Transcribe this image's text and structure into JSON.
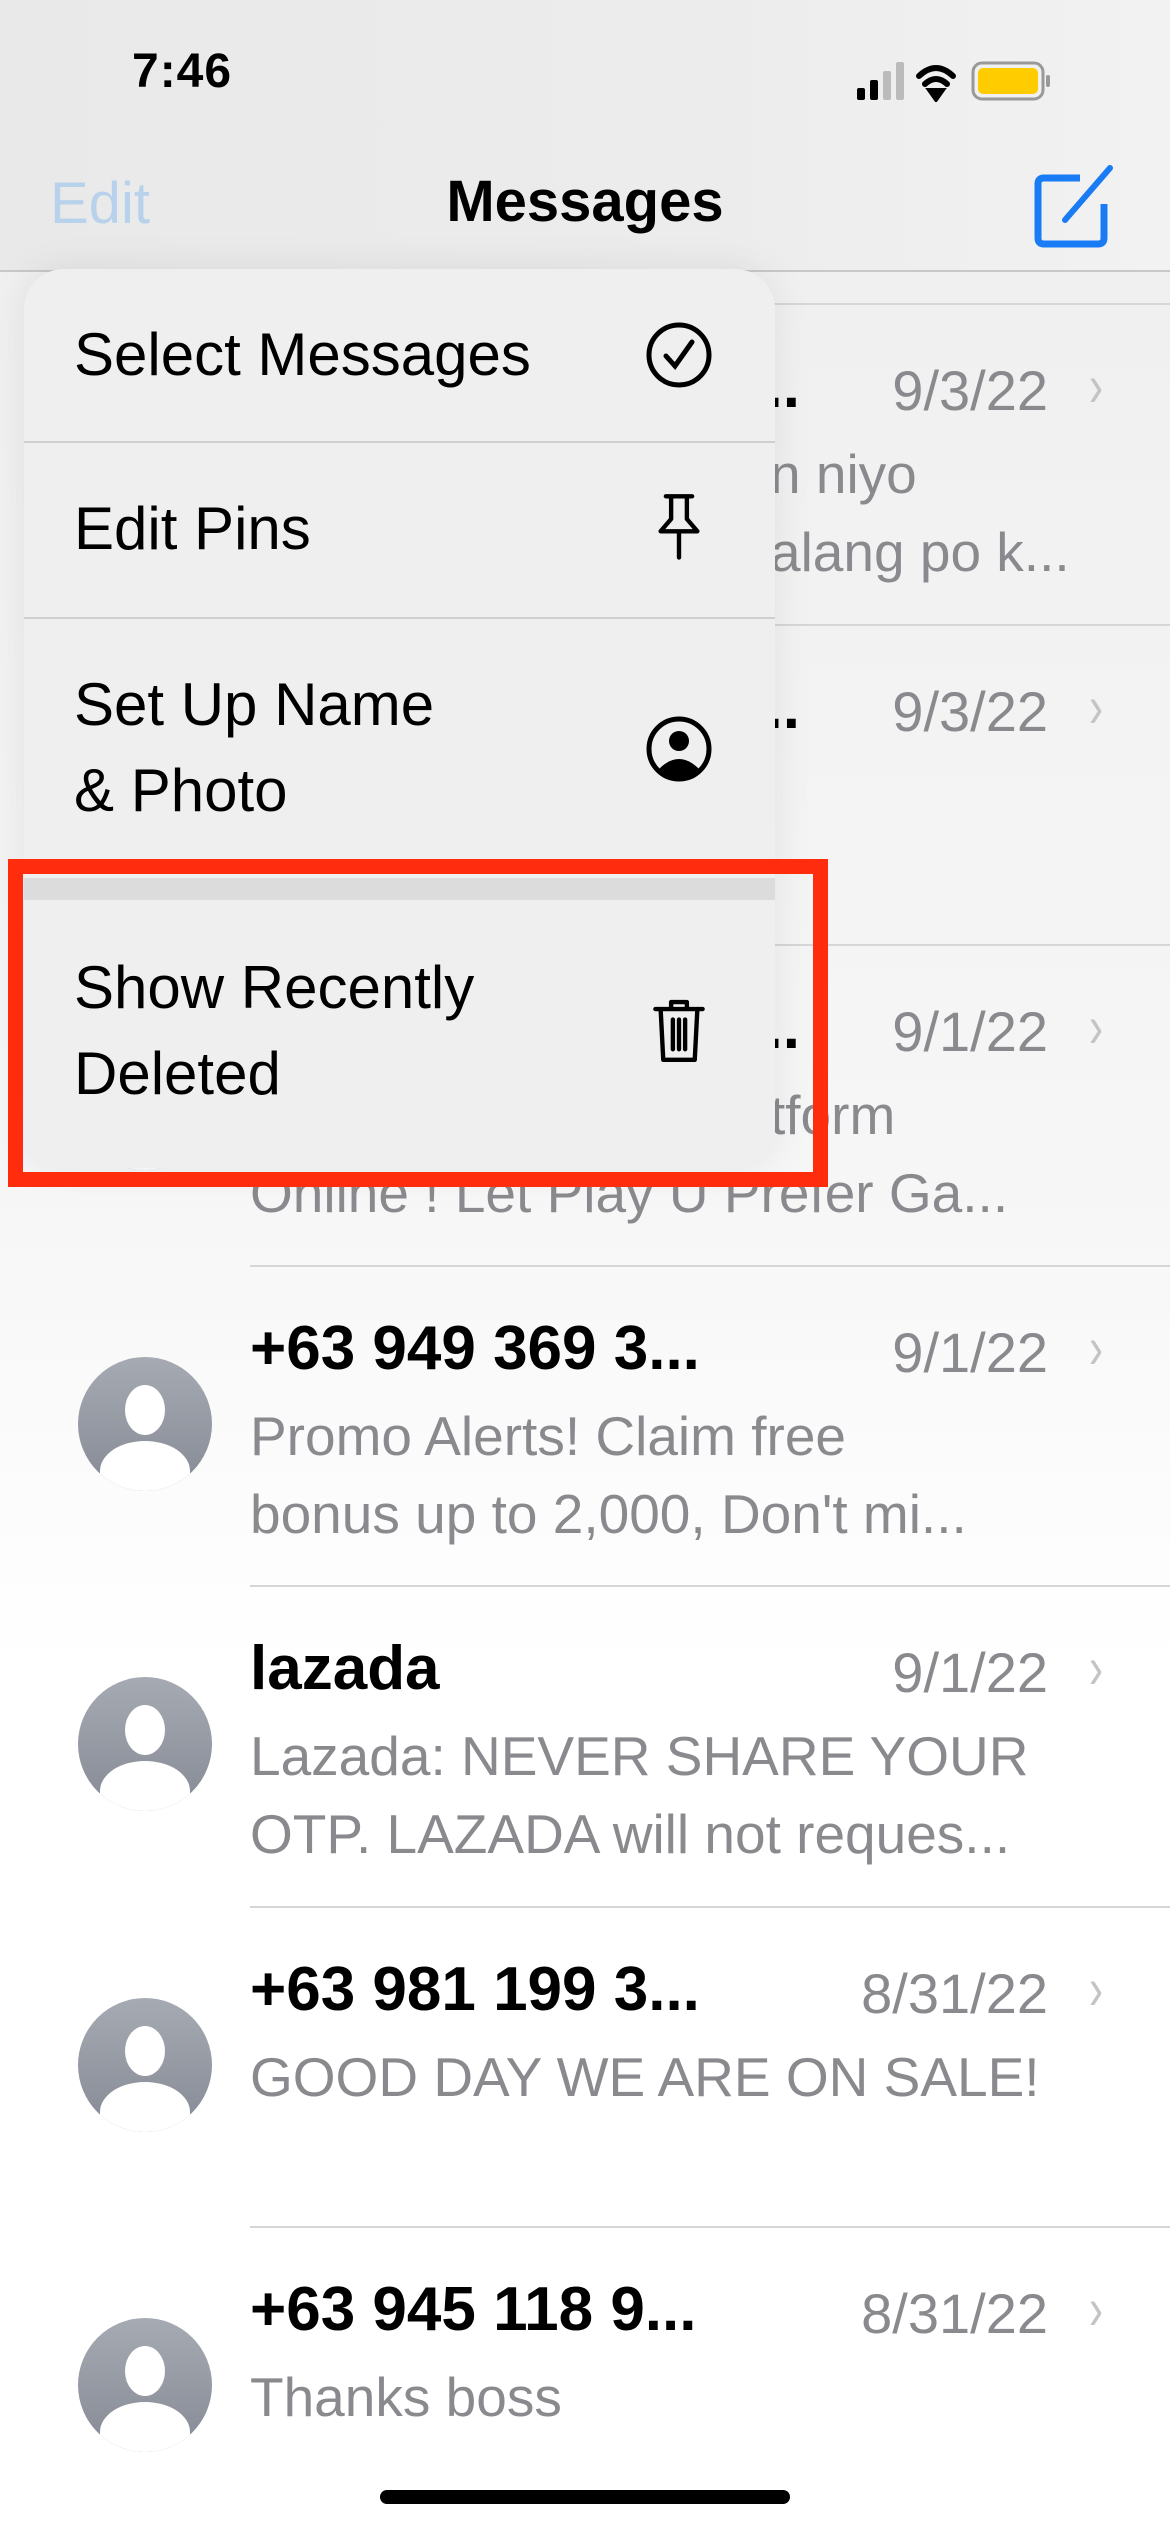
{
  "status_bar": {
    "time": "7:46",
    "battery_color": "#ffcc00"
  },
  "nav": {
    "edit_label": "Edit",
    "title": "Messages",
    "compose_icon": "compose-icon",
    "accent": "#1a7cf5"
  },
  "conversations": [
    {
      "name": "...",
      "date": "9/3/22",
      "preview": [
        "n niyo",
        "alang po k..."
      ],
      "obscured": true
    },
    {
      "name": "..",
      "date": "9/3/22",
      "preview": [],
      "obscured": true
    },
    {
      "name": "..",
      "date": "9/1/22",
      "preview": [
        "tform",
        "Online ! Let Play U Prefer Ga..."
      ],
      "obscured": true
    },
    {
      "name": "+63 949 369 3...",
      "date": "9/1/22",
      "preview": [
        "Promo Alerts! Claim free",
        "bonus up to 2,000, Don't mi..."
      ]
    },
    {
      "name": "lazada",
      "date": "9/1/22",
      "preview": [
        "Lazada: NEVER SHARE YOUR",
        "OTP. LAZADA will not reques..."
      ]
    },
    {
      "name": "+63 981 199 3...",
      "date": "8/31/22",
      "preview": [
        "GOOD DAY WE ARE ON SALE!"
      ]
    },
    {
      "name": "+63 945 118 9...",
      "date": "8/31/22",
      "preview": [
        "Thanks boss"
      ]
    }
  ],
  "menu": {
    "items": [
      {
        "label": "Select Messages",
        "icon": "checkmark-circle-icon"
      },
      {
        "label": "Edit Pins",
        "icon": "pin-icon"
      },
      {
        "label": "Set Up Name\n& Photo",
        "icon": "person-circle-icon"
      },
      {
        "label": "Show Recently\nDeleted",
        "icon": "trash-icon",
        "highlighted": true
      }
    ]
  },
  "highlight_color": "#ff2d0d"
}
